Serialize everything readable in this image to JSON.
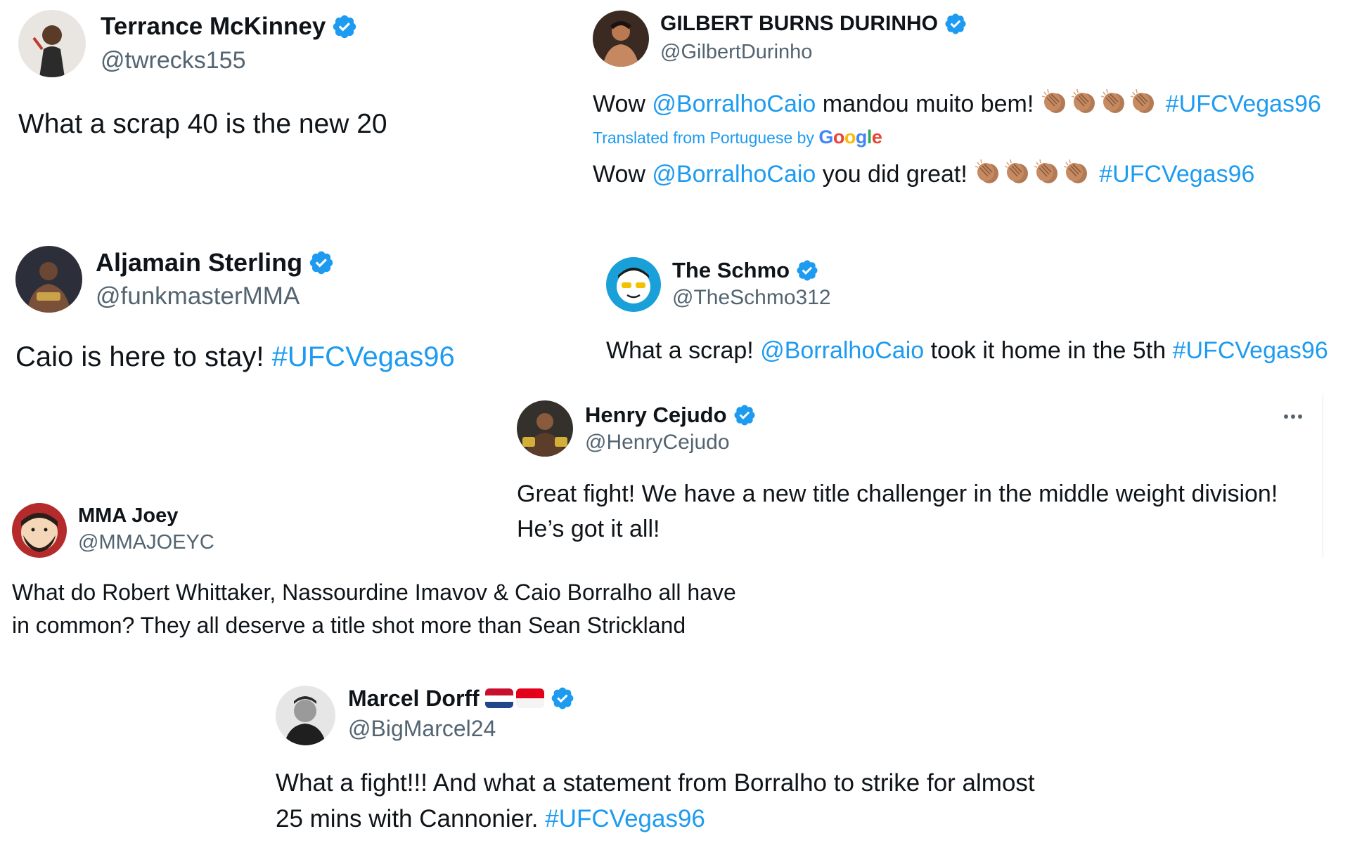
{
  "colors": {
    "link": "#1d9bf0",
    "verified": "#1d9bf0",
    "handle": "#536471",
    "text": "#0f1419"
  },
  "tweets": [
    {
      "name": "Terrance McKinney",
      "handle": "@twrecks155",
      "verified": true,
      "text": "What a scrap 40 is the new 20"
    },
    {
      "name": "GILBERT BURNS DURINHO",
      "handle": "@GilbertDurinho",
      "verified": true,
      "text_original": {
        "prefix": "Wow ",
        "mention": "@BorralhoCaio",
        "middle": " mandou muito bem! ",
        "hashtag": "#UFCVegas96"
      },
      "translation_note": "Translated from Portuguese by ",
      "translation_brand": "Google",
      "text_translated": {
        "prefix": "Wow ",
        "mention": "@BorralhoCaio",
        "middle": " you did great! ",
        "hashtag": "#UFCVegas96"
      },
      "emoji": "clapping-hands"
    },
    {
      "name": "Aljamain Sterling",
      "handle": "@funkmasterMMA",
      "verified": true,
      "text": "Caio is here to stay! ",
      "hashtag": "#UFCVegas96"
    },
    {
      "name": "The Schmo",
      "handle": "@TheSchmo312",
      "verified": true,
      "text_parts": {
        "prefix": "What a scrap! ",
        "mention": "@BorralhoCaio",
        "middle": " took it home in the 5th ",
        "hashtag": "#UFCVegas96"
      }
    },
    {
      "name": "Henry Cejudo",
      "handle": "@HenryCejudo",
      "verified": true,
      "text_line1": "Great fight! We have a new title challenger in the middle weight division!",
      "text_line2": "He’s got it all!",
      "menu_icon": "more-icon"
    },
    {
      "name": "MMA Joey",
      "handle": "@MMAJOEYC",
      "verified": false,
      "text_line1": "What do Robert Whittaker, Nassourdine Imavov & Caio Borralho all have",
      "text_line2": "in common? They all deserve a title shot more than Sean Strickland"
    },
    {
      "name": "Marcel Dorff",
      "handle": "@BigMarcel24",
      "verified": true,
      "flags": [
        "netherlands-flag",
        "indonesia-flag"
      ],
      "text_line1": "What a fight!!! And what a statement from Borralho to strike for almost",
      "text_line2": "25 mins with Cannonier. ",
      "hashtag": "#UFCVegas96"
    }
  ]
}
